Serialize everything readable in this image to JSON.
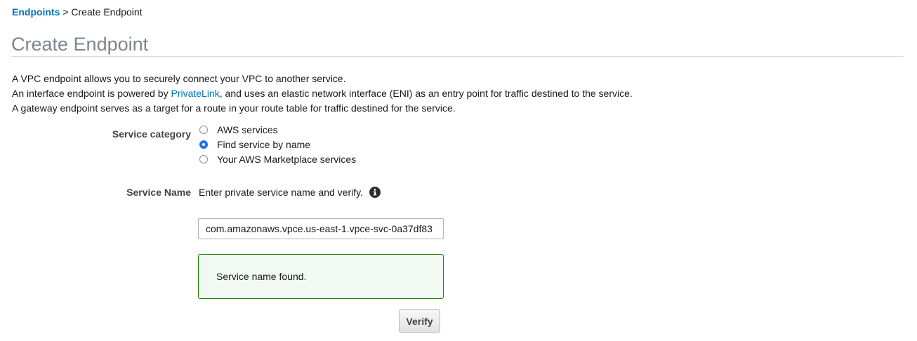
{
  "breadcrumb": {
    "parent": "Endpoints",
    "separator": " > ",
    "current": "Create Endpoint"
  },
  "page_title": "Create Endpoint",
  "intro": {
    "line1": "A VPC endpoint allows you to securely connect your VPC to another service.",
    "line2_before": "An interface endpoint is powered by ",
    "line2_link": "PrivateLink",
    "line2_after": ", and uses an elastic network interface (ENI) as an entry point for traffic destined to the service.",
    "line3": "A gateway endpoint serves as a target for a route in your route table for traffic destined for the service."
  },
  "service_category": {
    "label": "Service category",
    "options": [
      {
        "label": "AWS services",
        "selected": false
      },
      {
        "label": "Find service by name",
        "selected": true
      },
      {
        "label": "Your AWS Marketplace services",
        "selected": false
      }
    ]
  },
  "service_name": {
    "label": "Service Name",
    "hint": "Enter private service name and verify.",
    "info_icon": "info-circle-icon",
    "value": "com.amazonaws.vpce.us-east-1.vpce-svc-0a37df83"
  },
  "alert": {
    "text": "Service name found.",
    "color": "#1d8102"
  },
  "verify_label": "Verify",
  "colors": {
    "link": "#0073bb",
    "radio_selected": "#1f73e8"
  }
}
